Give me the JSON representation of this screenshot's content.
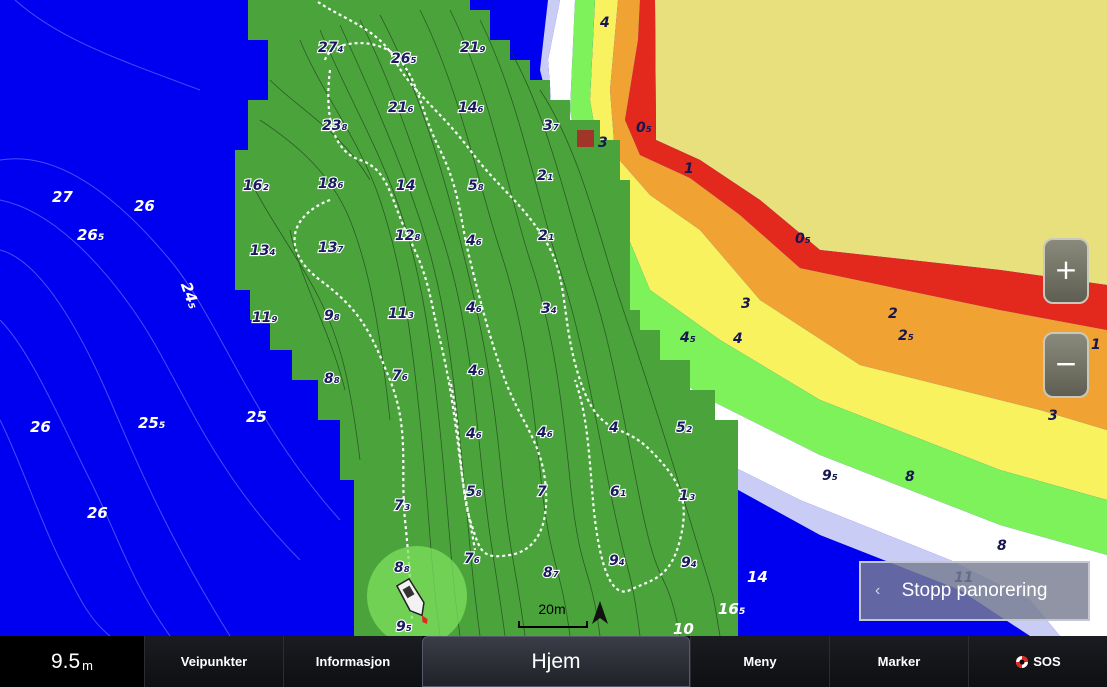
{
  "bottom_bar": {
    "depth_value": "9.5",
    "depth_unit": "m",
    "waypoints": "Veipunkter",
    "information": "Informasjon",
    "home": "Hjem",
    "menu": "Meny",
    "mark": "Marker",
    "sos": "SOS"
  },
  "map": {
    "zoom_in": "+",
    "zoom_out": "−",
    "stop_panning": "Stopp panorering",
    "scale": "20m",
    "deep_soundings": [
      "27",
      "26",
      "26₅",
      "24₅",
      "26",
      "25₅",
      "25",
      "26"
    ],
    "shaded_soundings": [
      "27₄",
      "26₅",
      "21₉",
      "21₆",
      "14₆",
      "23₈",
      "3₇",
      "16₂",
      "18₆",
      "14",
      "5₈",
      "2₁",
      "13₄",
      "13₇",
      "12₈",
      "4₆",
      "2₁",
      "11₉",
      "9₈",
      "11₃",
      "4₆",
      "3₄",
      "8₈",
      "7₆",
      "4₆",
      "4₆",
      "4₆",
      "4",
      "5₂",
      "7₃",
      "5₈",
      "7",
      "6₁",
      "1₃",
      "7₆",
      "9₄",
      "9₄",
      "8₇",
      "8₈",
      "9₅"
    ],
    "coast_soundings": [
      "4",
      "3",
      "0₅",
      "1",
      "0₅",
      "3",
      "4₅",
      "4",
      "2",
      "2₅",
      "1",
      "3",
      "9₅",
      "8",
      "8",
      "14",
      "16₅",
      "10",
      "11"
    ]
  },
  "colors": {
    "deep_water": "#0000f0",
    "shallow_fill": "#4aa43b",
    "land": "#e8e07c",
    "depth_red": "#e3291d",
    "depth_orange": "#f0a233",
    "depth_yellow": "#f7f25e",
    "depth_green": "#7df25a"
  }
}
